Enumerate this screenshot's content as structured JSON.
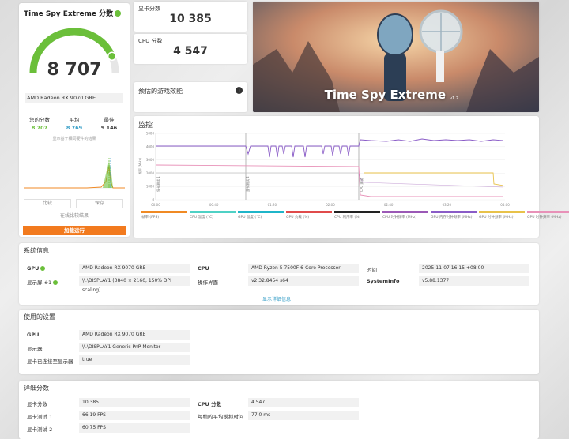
{
  "score_card": {
    "title": "Time Spy Extreme 分数",
    "score": "8 707",
    "gauge_fraction": 0.87,
    "gpu_name": "AMD Radeon RX 9070 GRE",
    "stats": [
      {
        "label": "您的分数",
        "value": "8 707",
        "color": "#6bbf3a"
      },
      {
        "label": "平均",
        "value": "8 769",
        "color": "#3aa0c8"
      },
      {
        "label": "最佳",
        "value": "9 146",
        "color": "#333333",
        "info": "i"
      }
    ],
    "mini_chart_caption": "显示基于相同硬件的结果",
    "btn_compare": "比较",
    "btn_share": "保存",
    "btn_online": "在线比较结果",
    "btn_main": "加载运行"
  },
  "gpu_score": {
    "title": "显卡分数",
    "value": "10 385"
  },
  "cpu_score": {
    "title": "CPU 分数",
    "value": "4 547"
  },
  "estimated": {
    "title": "预估的游戏效能",
    "info": "i"
  },
  "hero": {
    "title": "Time Spy Extreme",
    "version": "v1.2"
  },
  "monitor": {
    "title": "监控",
    "y_label": "频率 (MHz)",
    "y_ticks": [
      "5000",
      "4000",
      "3000",
      "2000",
      "1000",
      "0"
    ],
    "x_ticks": [
      "00:00",
      "00:40",
      "01:20",
      "02:00",
      "02:40",
      "03:20",
      "04:00"
    ],
    "markers": [
      "显卡测试 1",
      "显卡测试 2",
      "CPU 测试"
    ],
    "legend": [
      {
        "label": "帧率 (FPS)",
        "color": "#f08a24"
      },
      {
        "label": "CPU 温度 (°C)",
        "color": "#4fd1c5"
      },
      {
        "label": "GPU 温度 (°C)",
        "color": "#1fb5c9"
      },
      {
        "label": "GPU 负载 (%)",
        "color": "#e04b4b"
      },
      {
        "label": "CPU 利用率 (%)",
        "color": "#222222"
      },
      {
        "label": "CPU 时钟频率 (MHz)",
        "color": "#9b59b6"
      },
      {
        "label": "GPU 内存时钟频率 (MHz)",
        "color": "#8a5cc7"
      },
      {
        "label": "GPU 时钟频率 (MHz)",
        "color": "#e8c24a"
      },
      {
        "label": "GPU 时钟频率 (MHz)",
        "color": "#e891b8"
      }
    ]
  },
  "system_info": {
    "title": "系统信息",
    "gpu_label": "GPU",
    "gpu_value": "AMD Radeon RX 9070 GRE",
    "display_label": "显示屏 #1",
    "display_value": "\\\\.\\DISPLAY1 (3840 × 2160, 150% DPI scaling)",
    "cpu_label": "CPU",
    "cpu_value": "AMD Ryzen 5 7500F 6-Core Processor",
    "os_label": "操作界面",
    "os_value": "v2.32.8454 s64",
    "time_label": "时间",
    "time_value": "2025-11-07 16:15 +08:00",
    "sysinfo_label": "SystemInfo",
    "sysinfo_value": "v5.88.1377",
    "details_link": "显示详细信息"
  },
  "settings": {
    "title": "使用的设置",
    "rows": [
      {
        "label": "GPU",
        "value": "AMD Radeon RX 9070 GRE"
      },
      {
        "label": "显示器",
        "value": "\\\\.\\DISPLAY1 Generic PnP Monitor"
      },
      {
        "label": "显卡已连接至显示器",
        "value": "true"
      }
    ]
  },
  "detailed": {
    "title": "详细分数",
    "left": [
      {
        "label": "显卡分数",
        "value": "10 385"
      },
      {
        "label": "显卡测试 1",
        "value": "66.19 FPS"
      },
      {
        "label": "显卡测试 2",
        "value": "60.75 FPS"
      }
    ],
    "right": [
      {
        "label": "CPU 分数",
        "value": "4 547"
      },
      {
        "label": "每帧的平均模拟时间",
        "value": "77.0 ms"
      }
    ]
  }
}
